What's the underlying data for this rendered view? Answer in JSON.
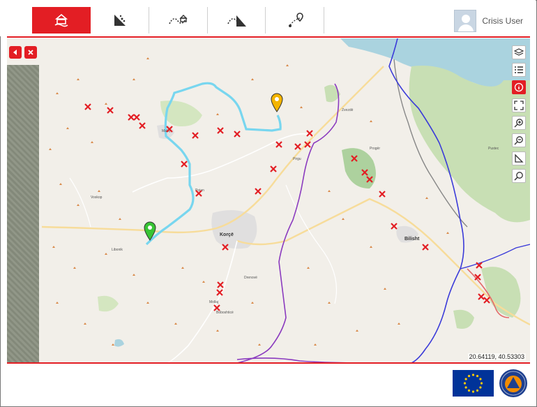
{
  "toolbar": {
    "tools": [
      {
        "icon": "hazard-report-icon",
        "active": true
      },
      {
        "icon": "landslide-icon",
        "active": false
      },
      {
        "icon": "route-hazard-icon",
        "active": false
      },
      {
        "icon": "route-landslide-icon",
        "active": false
      },
      {
        "icon": "route-pins-icon",
        "active": false
      }
    ],
    "accent_color": "#e31e24"
  },
  "user": {
    "name": "Crisis User"
  },
  "map": {
    "coordinates": "20.64119, 40.53303",
    "controls": [
      "layers-icon",
      "list-icon",
      "info-icon",
      "fullscreen-icon",
      "zoom-in-icon",
      "zoom-out-icon",
      "measure-icon",
      "search-icon"
    ],
    "panel_buttons": [
      "back-icon",
      "close-icon"
    ],
    "places": [
      {
        "name": "Korçë",
        "town": true
      },
      {
        "name": "Bilisht",
        "town": true
      },
      {
        "name": "Maliq",
        "town": false
      },
      {
        "name": "Pirgu",
        "town": false
      },
      {
        "name": "Drenovë",
        "town": false
      },
      {
        "name": "Progër",
        "town": false
      },
      {
        "name": "Zvezdë",
        "town": false
      },
      {
        "name": "Pojan",
        "town": false
      },
      {
        "name": "Mollaj",
        "town": false
      },
      {
        "name": "Boboshticë",
        "town": false
      },
      {
        "name": "Voskop",
        "town": false
      },
      {
        "name": "Libonik",
        "town": false
      },
      {
        "name": "Pustec",
        "town": false
      }
    ]
  },
  "footer": {
    "logos": [
      "eu-flag-icon",
      "civil-protection-logo-icon"
    ]
  }
}
